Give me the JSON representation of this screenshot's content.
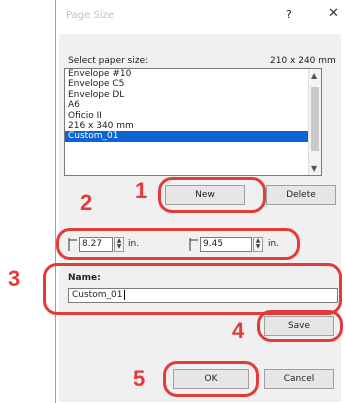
{
  "dialog": {
    "title": "Page Size",
    "help_label": "?",
    "close_label": "✕"
  },
  "paper": {
    "label": "Select paper size:",
    "current_size": "210 x 240 mm",
    "items": [
      {
        "label": "Envelope #10",
        "selected": false
      },
      {
        "label": "Envelope C5",
        "selected": false
      },
      {
        "label": "Envelope DL",
        "selected": false
      },
      {
        "label": "A6",
        "selected": false
      },
      {
        "label": "Oficio II",
        "selected": false
      },
      {
        "label": "216 x 340 mm",
        "selected": false
      },
      {
        "label": "Custom_01",
        "selected": true
      }
    ]
  },
  "buttons": {
    "new": "New",
    "delete": "Delete",
    "save": "Save",
    "ok": "OK",
    "cancel": "Cancel"
  },
  "dimensions": {
    "width_value": "8.27",
    "width_unit": "in.",
    "height_value": "9.45",
    "height_unit": "in."
  },
  "name": {
    "label": "Name:",
    "value": "Custom_01"
  },
  "callouts": [
    "1",
    "2",
    "3",
    "4",
    "5"
  ],
  "colors": {
    "accent": "#e33a3a",
    "selection": "#0a64d4"
  }
}
